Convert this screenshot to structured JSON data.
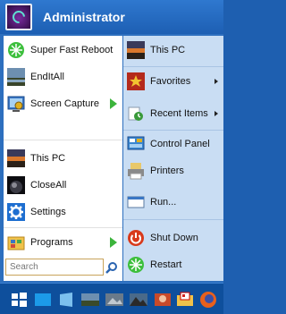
{
  "header": {
    "username": "Administrator"
  },
  "left_items": [
    {
      "label": "Super Fast Reboot",
      "icon": "green-burst-icon"
    },
    {
      "label": "EndItAll",
      "icon": "landscape-icon"
    },
    {
      "label": "Screen Capture",
      "icon": "screen-capture-icon"
    },
    {
      "label": "This PC",
      "icon": "sunset-landscape-icon"
    },
    {
      "label": "CloseAll",
      "icon": "dark-planet-icon"
    },
    {
      "label": "Settings",
      "icon": "gear-icon"
    }
  ],
  "programs": {
    "label": "Programs",
    "icon": "programs-folder-icon"
  },
  "search": {
    "placeholder": "Search"
  },
  "right_items": [
    {
      "label": "This PC",
      "icon": "sunset-landscape-icon"
    },
    {
      "label": "Favorites",
      "icon": "favorites-star-icon"
    },
    {
      "label": "Recent Items",
      "icon": "recent-items-icon"
    },
    {
      "label": "Control Panel",
      "icon": "control-panel-icon"
    },
    {
      "label": "Printers",
      "icon": "printer-icon"
    },
    {
      "label": "Run...",
      "icon": "run-icon"
    },
    {
      "label": "Shut Down",
      "icon": "power-icon"
    },
    {
      "label": "Restart",
      "icon": "restart-icon"
    }
  ],
  "taskbar": {
    "icons": [
      "windows-start-icon",
      "desktop-icon",
      "blue-window-icon",
      "landscape-icon",
      "image-icon",
      "mountain-icon",
      "portrait-icon",
      "folder-icon",
      "firefox-icon"
    ]
  },
  "colors": {
    "accent": "#2d6fbe",
    "right_panel": "#c9ddf3",
    "taskbar": "#0e4f9c",
    "arrow": "#3cb43c"
  }
}
